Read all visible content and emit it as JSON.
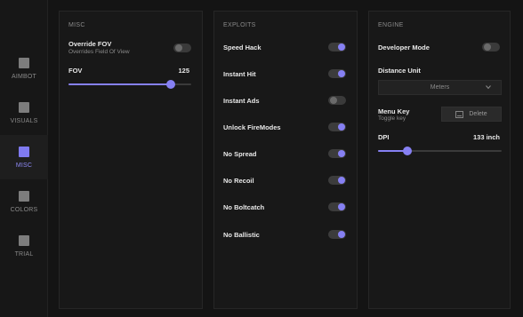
{
  "sidebar": {
    "items": [
      {
        "label": "AIMBOT",
        "active": false
      },
      {
        "label": "VISUALS",
        "active": false
      },
      {
        "label": "MISC",
        "active": true
      },
      {
        "label": "COLORS",
        "active": false
      },
      {
        "label": "TRIAL",
        "active": false
      }
    ]
  },
  "misc": {
    "title": "MISC",
    "override_fov": {
      "label": "Override FOV",
      "sublabel": "Overrides Field Of View",
      "on": false
    },
    "fov": {
      "label": "FOV",
      "value": "125",
      "fraction": 0.83
    }
  },
  "exploits": {
    "title": "EXPLOITS",
    "items": [
      {
        "label": "Speed Hack",
        "on": true
      },
      {
        "label": "Instant Hit",
        "on": true
      },
      {
        "label": "Instant Ads",
        "on": false
      },
      {
        "label": "Unlock FireModes",
        "on": true
      },
      {
        "label": "No Spread",
        "on": true
      },
      {
        "label": "No Recoil",
        "on": true
      },
      {
        "label": "No Boltcatch",
        "on": true
      },
      {
        "label": "No Ballistic",
        "on": true
      }
    ]
  },
  "engine": {
    "title": "ENGINE",
    "developer_mode": {
      "label": "Developer Mode",
      "on": false
    },
    "distance_unit": {
      "label": "Distance Unit",
      "value": "Meters"
    },
    "menu_key": {
      "label": "Menu Key",
      "sublabel": "Toggle key",
      "button_label": "Delete"
    },
    "dpi": {
      "label": "DPI",
      "value": "133 inch",
      "fraction": 0.24
    }
  },
  "colors": {
    "accent": "#8680f3",
    "background": "#141414",
    "panel": "#181818"
  }
}
